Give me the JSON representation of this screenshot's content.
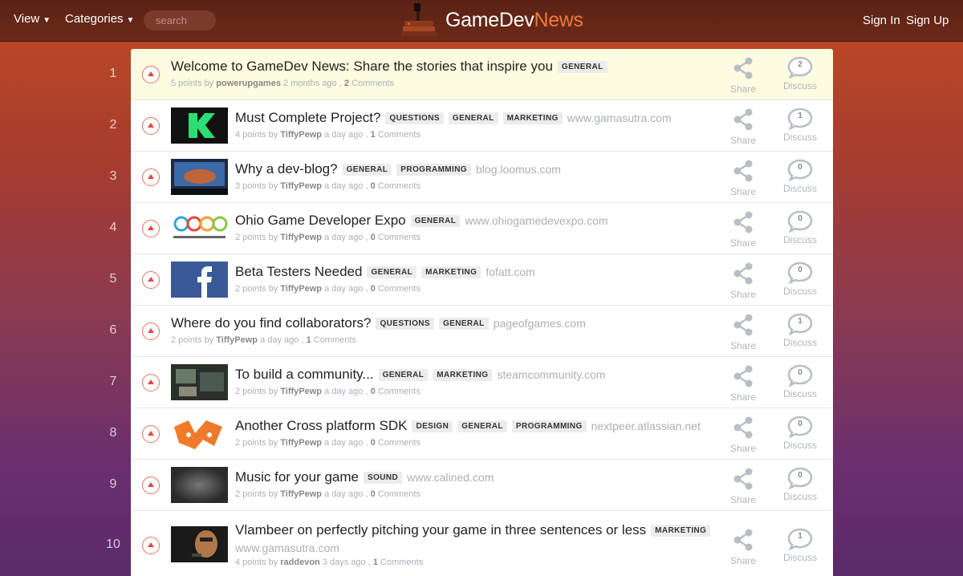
{
  "nav": {
    "view_label": "View",
    "categories_label": "Categories",
    "search_placeholder": "search",
    "brand_prefix": "GameDev",
    "brand_suffix": "News",
    "signin_label": "Sign In",
    "signup_label": "Sign Up"
  },
  "colors": {
    "accent": "#f07a3a",
    "upvote": "#e8453b",
    "featured_bg": "#fdfbe0"
  },
  "labels": {
    "share": "Share",
    "discuss": "Discuss"
  },
  "posts": [
    {
      "rank": "1",
      "title": "Welcome to GameDev News: Share the stories that inspire you",
      "tags": [
        "GENERAL"
      ],
      "domain": "",
      "points": "5 points",
      "author": "powerupgames",
      "time": "2 months ago",
      "comments": "2",
      "featured": true,
      "thumb": "none"
    },
    {
      "rank": "2",
      "title": "Must Complete Project?",
      "tags": [
        "QUESTIONS",
        "GENERAL",
        "MARKETING"
      ],
      "domain": "www.gamasutra.com",
      "points": "4 points",
      "author": "TiffyPewp",
      "time": "a day ago",
      "comments": "1",
      "thumb": "kickstarter"
    },
    {
      "rank": "3",
      "title": "Why a dev-blog?",
      "tags": [
        "GENERAL",
        "PROGRAMMING"
      ],
      "domain": "blog.loomus.com",
      "points": "3 points",
      "author": "TiffyPewp",
      "time": "a day ago",
      "comments": "0",
      "thumb": "photo-blue"
    },
    {
      "rank": "4",
      "title": "Ohio Game Developer Expo",
      "tags": [
        "GENERAL"
      ],
      "domain": "www.ohiogamedevexpo.com",
      "points": "2 points",
      "author": "TiffyPewp",
      "time": "a day ago",
      "comments": "0",
      "thumb": "ogde"
    },
    {
      "rank": "5",
      "title": "Beta Testers Needed",
      "tags": [
        "GENERAL",
        "MARKETING"
      ],
      "domain": "fofatt.com",
      "points": "2 points",
      "author": "TiffyPewp",
      "time": "a day ago",
      "comments": "0",
      "thumb": "facebook"
    },
    {
      "rank": "6",
      "title": "Where do you find collaborators?",
      "tags": [
        "QUESTIONS",
        "GENERAL"
      ],
      "domain": "pageofgames.com",
      "points": "2 points",
      "author": "TiffyPewp",
      "time": "a day ago",
      "comments": "1",
      "thumb": "none"
    },
    {
      "rank": "7",
      "title": "To build a community...",
      "tags": [
        "GENERAL",
        "MARKETING"
      ],
      "domain": "steamcommunity.com",
      "points": "2 points",
      "author": "TiffyPewp",
      "time": "a day ago",
      "comments": "0",
      "thumb": "photo-dark"
    },
    {
      "rank": "8",
      "title": "Another Cross platform SDK",
      "tags": [
        "DESIGN",
        "GENERAL",
        "PROGRAMMING"
      ],
      "domain": "nextpeer.atlassian.net",
      "points": "2 points",
      "author": "TiffyPewp",
      "time": "a day ago",
      "comments": "0",
      "thumb": "orange-logo"
    },
    {
      "rank": "9",
      "title": "Music for your game",
      "tags": [
        "SOUND"
      ],
      "domain": "www.calined.com",
      "points": "2 points",
      "author": "TiffyPewp",
      "time": "a day ago",
      "comments": "0",
      "thumb": "gray"
    },
    {
      "rank": "10",
      "title": "Vlambeer on perfectly pitching your game in three sentences or less",
      "tags": [
        "MARKETING"
      ],
      "domain": "www.gamasutra.com",
      "points": "4 points",
      "author": "raddevon",
      "time": "3 days ago",
      "comments": "1",
      "thumb": "photo-person",
      "wrap": true
    }
  ]
}
